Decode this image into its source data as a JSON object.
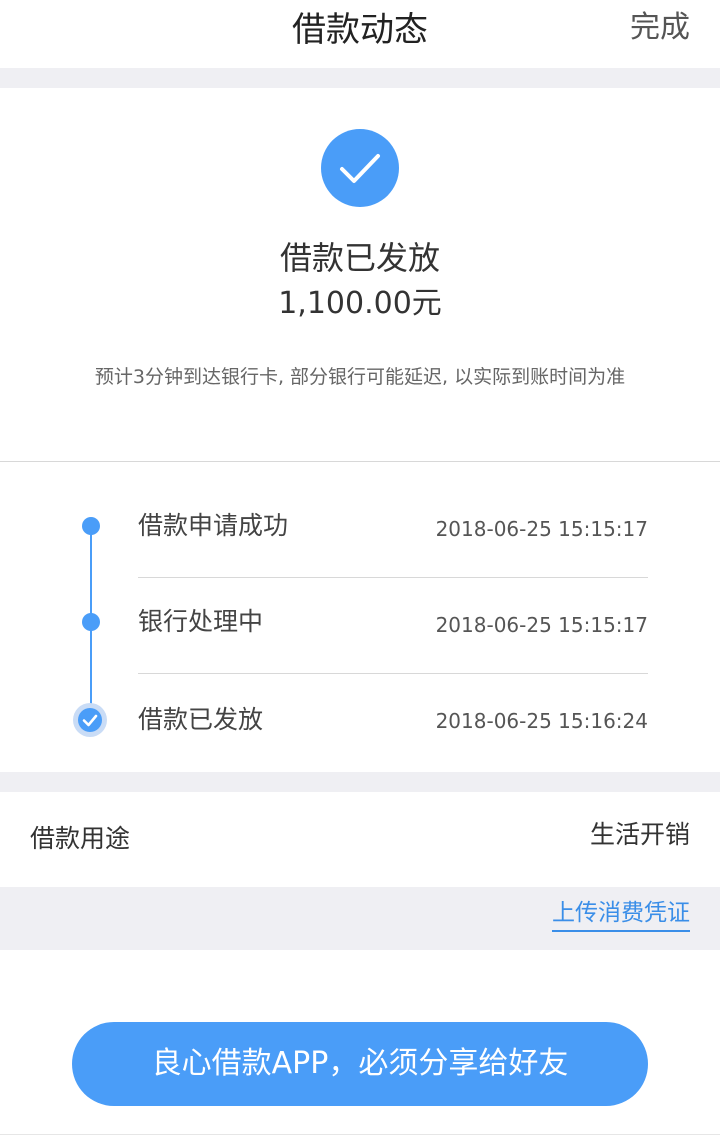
{
  "header": {
    "title": "借款动态",
    "done_label": "完成"
  },
  "status": {
    "title": "借款已发放",
    "amount": "1,100.00元",
    "notice": "预计3分钟到达银行卡, 部分银行可能延迟, 以实际到账时间为准"
  },
  "timeline": [
    {
      "label": "借款申请成功",
      "time": "2018-06-25 15:15:17"
    },
    {
      "label": "银行处理中",
      "time": "2018-06-25 15:15:17"
    },
    {
      "label": "借款已发放",
      "time": "2018-06-25 15:16:24"
    }
  ],
  "purpose": {
    "label": "借款用途",
    "value": "生活开销"
  },
  "upload": {
    "link_label": "上传消费凭证"
  },
  "share": {
    "button_label": "良心借款APP，必须分享给好友"
  },
  "colors": {
    "accent": "#4a9df8",
    "link": "#3a8ee8",
    "band": "#efeff3"
  }
}
